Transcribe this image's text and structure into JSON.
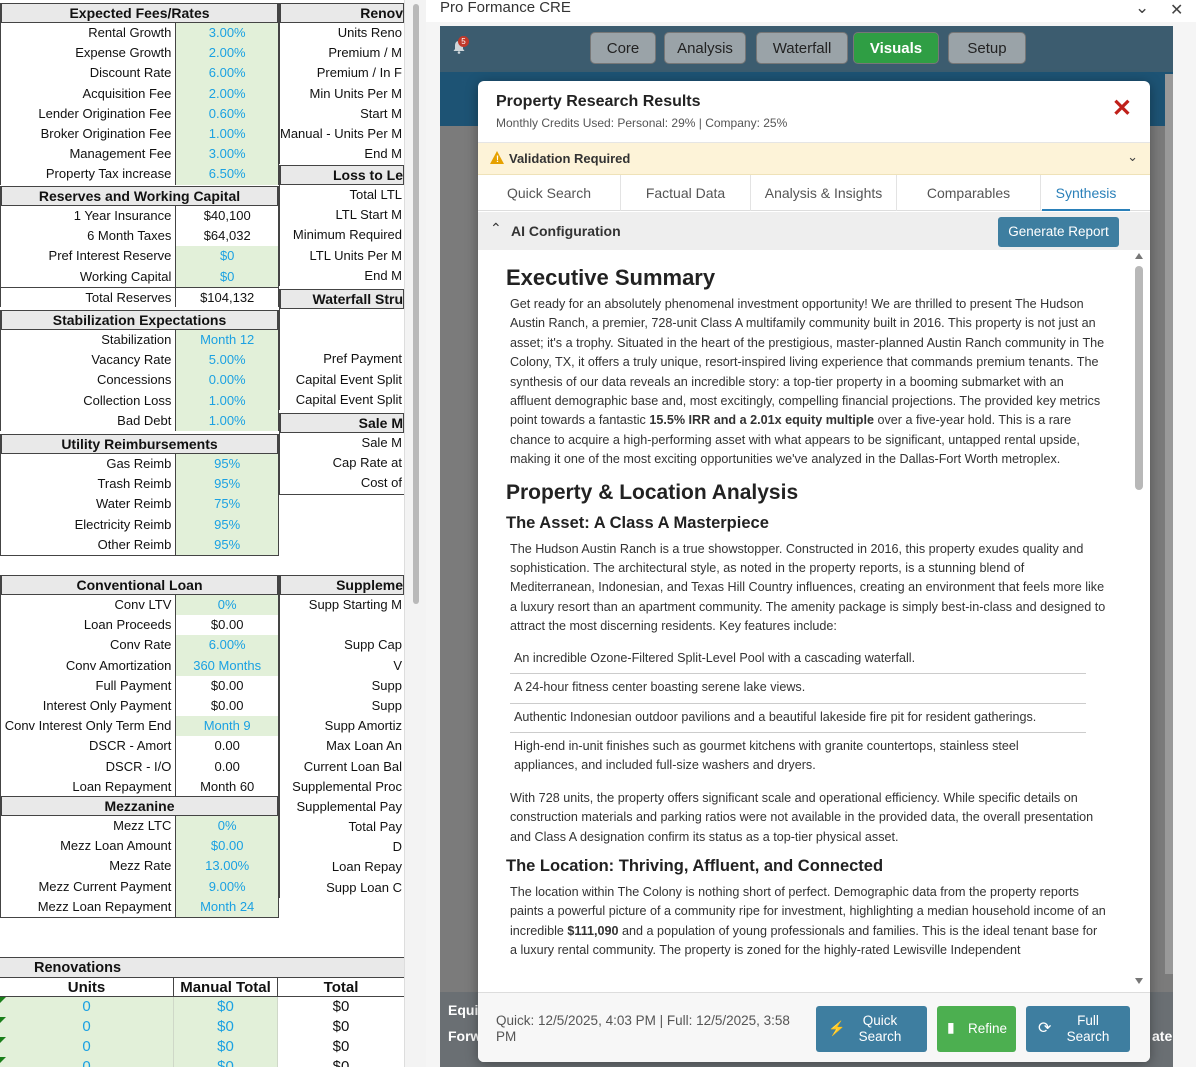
{
  "sheet": {
    "fees": {
      "header": "Expected Fees/Rates",
      "rows": [
        {
          "label": "Rental Growth",
          "value": "3.00%"
        },
        {
          "label": "Expense Growth",
          "value": "2.00%"
        },
        {
          "label": "Discount Rate",
          "value": "6.00%"
        },
        {
          "label": "Acquisition Fee",
          "value": "2.00%"
        },
        {
          "label": "Lender Origination Fee",
          "value": "0.60%"
        },
        {
          "label": "Broker Origination Fee",
          "value": "1.00%"
        },
        {
          "label": "Management Fee",
          "value": "3.00%"
        },
        {
          "label": "Property Tax increase",
          "value": "6.50%"
        }
      ]
    },
    "reserves": {
      "header": "Reserves and Working Capital",
      "rows": [
        {
          "label": "1 Year Insurance",
          "value": "$40,100"
        },
        {
          "label": "6 Month Taxes",
          "value": "$64,032"
        },
        {
          "label": "Pref Interest Reserve",
          "value": "$0"
        },
        {
          "label": "Working Capital",
          "value": "$0"
        },
        {
          "label": "Total Reserves",
          "value": "$104,132"
        }
      ]
    },
    "stabilization": {
      "header": "Stabilization Expectations",
      "rows": [
        {
          "label": "Stabilization",
          "value": "Month 12"
        },
        {
          "label": "Vacancy Rate",
          "value": "5.00%"
        },
        {
          "label": "Concessions",
          "value": "0.00%"
        },
        {
          "label": "Collection Loss",
          "value": "1.00%"
        },
        {
          "label": "Bad Debt",
          "value": "1.00%"
        }
      ]
    },
    "utility": {
      "header": "Utility Reimbursements",
      "rows": [
        {
          "label": "Gas Reimb",
          "value": "95%"
        },
        {
          "label": "Trash Reimb",
          "value": "95%"
        },
        {
          "label": "Water Reimb",
          "value": "75%"
        },
        {
          "label": "Electricity Reimb",
          "value": "95%"
        },
        {
          "label": "Other Reimb",
          "value": "95%"
        }
      ]
    },
    "conventional": {
      "header": "Conventional Loan",
      "rows": [
        {
          "label": "Conv LTV",
          "value": "0%"
        },
        {
          "label": "Loan Proceeds",
          "value": "$0.00"
        },
        {
          "label": "Conv Rate",
          "value": "6.00%"
        },
        {
          "label": "Conv Amortization",
          "value": "360 Months"
        },
        {
          "label": "Full Payment",
          "value": "$0.00"
        },
        {
          "label": "Interest Only Payment",
          "value": "$0.00"
        },
        {
          "label": "Conv Interest Only Term End",
          "value": "Month 9"
        },
        {
          "label": "DSCR - Amort",
          "value": "0.00"
        },
        {
          "label": "DSCR - I/O",
          "value": "0.00"
        },
        {
          "label": "Loan Repayment",
          "value": "Month 60"
        }
      ]
    },
    "mezz": {
      "header": "Mezzanine",
      "rows": [
        {
          "label": "Mezz LTC",
          "value": "0%"
        },
        {
          "label": "Mezz Loan Amount",
          "value": "$0.00"
        },
        {
          "label": "Mezz Rate",
          "value": "13.00%"
        },
        {
          "label": "Mezz Current Payment",
          "value": "9.00%"
        },
        {
          "label": "Mezz Loan Repayment",
          "value": "Month 24"
        }
      ]
    },
    "right_col": {
      "reno_header": "Renov",
      "reno_rows": [
        "Units Reno",
        "Premium / M",
        "Premium / In F",
        "Min Units Per M",
        "Start M",
        "Manual - Units Per M",
        "End M"
      ],
      "loss_header": "Loss to Le",
      "loss_rows": [
        "Total LTL",
        "LTL Start M",
        "Minimum Required",
        "LTL Units Per M",
        "End M"
      ],
      "waterfall_header": "Waterfall Stru",
      "waterfall_rows": [
        "",
        "",
        "Pref Payment",
        "Capital Event Split",
        "Capital Event Split"
      ],
      "sale_header": "Sale M",
      "sale_rows": [
        "Sale M",
        "Cap Rate at",
        "Cost of"
      ],
      "supp_header": "Suppleme",
      "supp_rows": [
        "Supp Starting M",
        "",
        "Supp Cap",
        "V",
        "Supp",
        "Supp",
        "Supp Amortiz",
        "Max Loan An",
        "Current Loan Bal",
        "Supplemental Proc",
        "Supplemental Pay",
        "Total Pay",
        "D",
        "Loan Repay",
        "Supp Loan C"
      ]
    },
    "renovations": {
      "title": "Renovations",
      "columns": [
        "Units",
        "Manual Total",
        "Total"
      ],
      "rows": [
        {
          "units": "0",
          "manual": "$0",
          "total": "$0"
        },
        {
          "units": "0",
          "manual": "$0",
          "total": "$0"
        },
        {
          "units": "0",
          "manual": "$0",
          "total": "$0"
        },
        {
          "units": "0",
          "manual": "$0",
          "total": "$0"
        }
      ]
    }
  },
  "app": {
    "window_title": "Pro Formance CRE",
    "notification_count": "5",
    "nav": [
      {
        "label": "Core",
        "active": false
      },
      {
        "label": "Analysis",
        "active": false
      },
      {
        "label": "Waterfall",
        "active": false
      },
      {
        "label": "Visuals",
        "active": true
      },
      {
        "label": "Setup",
        "active": false
      }
    ],
    "bottom_labels": [
      "Equi",
      "Forw",
      "ate"
    ]
  },
  "modal": {
    "title": "Property Research Results",
    "subtitle": "Monthly Credits Used: Personal: 29% | Company: 25%",
    "validation": "Validation Required",
    "tabs": [
      {
        "label": "Quick Search",
        "active": false
      },
      {
        "label": "Factual Data",
        "active": false
      },
      {
        "label": "Analysis & Insights",
        "active": false
      },
      {
        "label": "Comparables",
        "active": false
      },
      {
        "label": "Synthesis",
        "active": true
      }
    ],
    "ai_config_label": "AI Configuration",
    "generate_label": "Generate Report",
    "content": {
      "h1": "Executive Summary",
      "p1a": "Get ready for an absolutely phenomenal investment opportunity! We are thrilled to present The Hudson Austin Ranch, a premier, 728-unit Class A multifamily community built in 2016. This property is not just an asset; it's a trophy. Situated in the heart of the prestigious, master-planned Austin Ranch community in The Colony, TX, it offers a truly unique, resort-inspired living experience that commands premium tenants. The synthesis of our data reveals an incredible story: a top-tier property in a booming submarket with an affluent demographic base and, most excitingly, compelling financial projections. The provided key metrics point towards a fantastic ",
      "p1b": "15.5% IRR and a 2.01x equity multiple",
      "p1c": " over a five-year hold. This is a rare chance to acquire a high-performing asset with what appears to be significant, untapped rental upside, making it one of the most exciting opportunities we've analyzed in the Dallas-Fort Worth metroplex.",
      "h2": "Property & Location Analysis",
      "h3a": "The Asset: A Class A Masterpiece",
      "p2": "The Hudson Austin Ranch is a true showstopper. Constructed in 2016, this property exudes quality and sophistication. The architectural style, as noted in the property reports, is a stunning blend of Mediterranean, Indonesian, and Texas Hill Country influences, creating an environment that feels more like a luxury resort than an apartment community. The amenity package is simply best-in-class and designed to attract the most discerning residents. Key features include:",
      "features": [
        "An incredible Ozone-Filtered Split-Level Pool with a cascading waterfall.",
        "A 24-hour fitness center boasting serene lake views.",
        "Authentic Indonesian outdoor pavilions and a beautiful lakeside fire pit for resident gatherings.",
        "High-end in-unit finishes such as gourmet kitchens with granite countertops, stainless steel appliances, and included full-size washers and dryers."
      ],
      "p3": "With 728 units, the property offers significant scale and operational efficiency. While specific details on construction materials and parking ratios were not available in the provided data, the overall presentation and Class A designation confirm its status as a top-tier physical asset.",
      "h3b": "The Location: Thriving, Affluent, and Connected",
      "p4a": "The location within The Colony is nothing short of perfect. Demographic data from the property reports paints a powerful picture of a community ripe for investment, highlighting a median household income of an incredible ",
      "p4b": "$111,090",
      "p4c": " and a population of young professionals and families. This is the ideal tenant base for a luxury rental community. The property is zoned for the highly-rated Lewisville Independent"
    },
    "footer_text": "Quick: 12/5/2025, 4:03 PM | Full: 12/5/2025, 3:58 PM",
    "quick_label": "Quick Search",
    "refine_label": "Refine",
    "full_label": "Full Search"
  }
}
